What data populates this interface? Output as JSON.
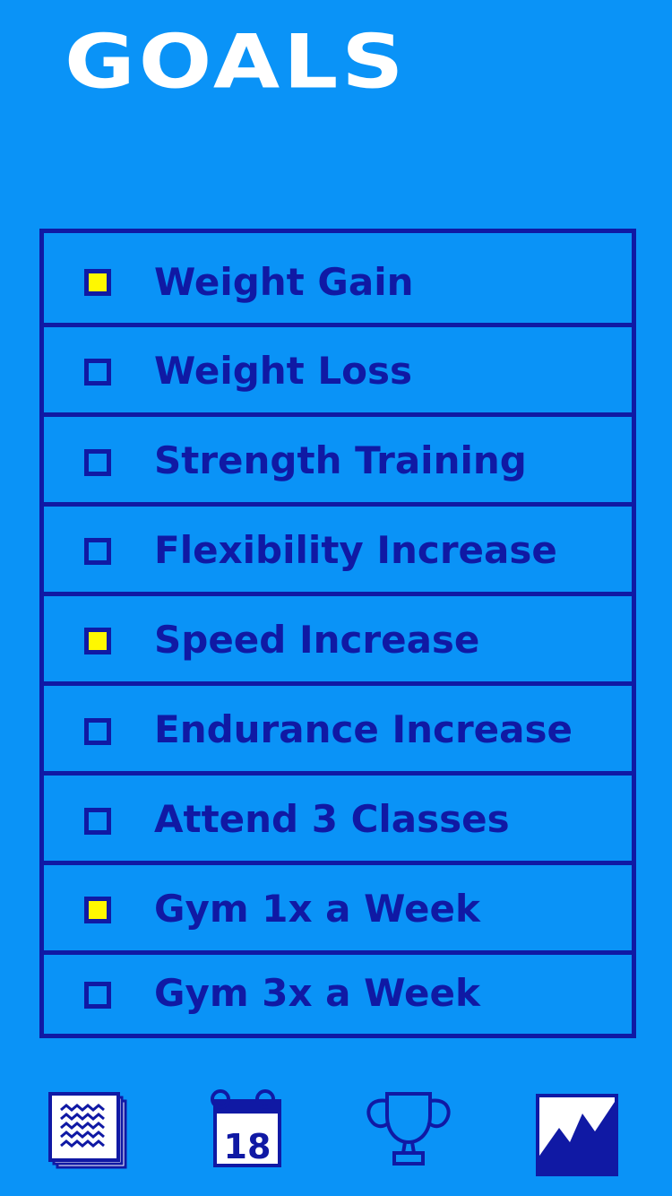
{
  "header": {
    "title": "GOALS"
  },
  "goals": [
    {
      "label": "Weight Gain",
      "checked": true
    },
    {
      "label": "Weight Loss",
      "checked": false
    },
    {
      "label": "Strength Training",
      "checked": false
    },
    {
      "label": "Flexibility Increase",
      "checked": false
    },
    {
      "label": "Speed Increase",
      "checked": true
    },
    {
      "label": "Endurance Increase",
      "checked": false
    },
    {
      "label": "Attend 3 Classes",
      "checked": false
    },
    {
      "label": "Gym 1x a Week",
      "checked": true
    },
    {
      "label": "Gym 3x a Week",
      "checked": false
    }
  ],
  "tabbar": {
    "calendar_day": "18",
    "icons": [
      "notes-icon",
      "calendar-icon",
      "trophy-icon",
      "chart-icon"
    ]
  },
  "colors": {
    "background": "#0A93F7",
    "accent": "#1019A4",
    "checked": "#FFF800",
    "title": "#FFFFFF"
  }
}
